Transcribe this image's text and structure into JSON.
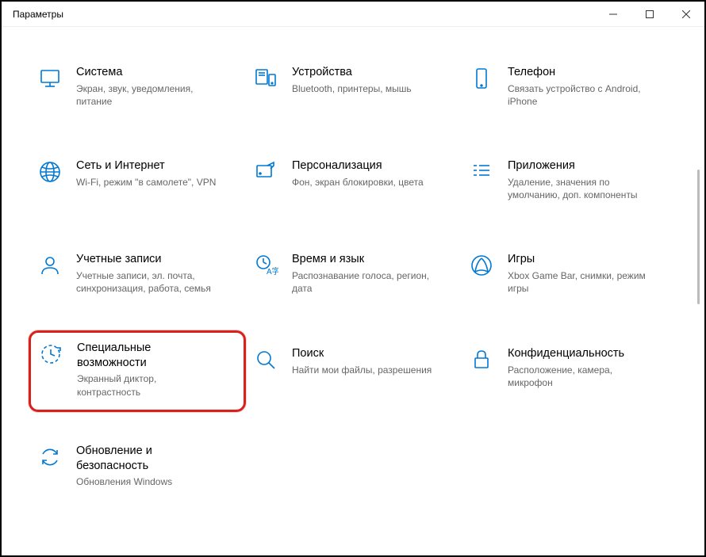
{
  "window": {
    "title": "Параметры"
  },
  "tiles": [
    {
      "title": "Система",
      "desc": "Экран, звук, уведомления, питание"
    },
    {
      "title": "Устройства",
      "desc": "Bluetooth, принтеры, мышь"
    },
    {
      "title": "Телефон",
      "desc": "Связать устройство с Android, iPhone"
    },
    {
      "title": "Сеть и Интернет",
      "desc": "Wi-Fi, режим \"в самолете\", VPN"
    },
    {
      "title": "Персонализация",
      "desc": "Фон, экран блокировки, цвета"
    },
    {
      "title": "Приложения",
      "desc": "Удаление, значения по умолчанию, доп. компоненты"
    },
    {
      "title": "Учетные записи",
      "desc": "Учетные записи, эл. почта, синхронизация, работа, семья"
    },
    {
      "title": "Время и язык",
      "desc": "Распознавание голоса, регион, дата"
    },
    {
      "title": "Игры",
      "desc": "Xbox Game Bar, снимки, режим игры"
    },
    {
      "title": "Специальные возможности",
      "desc": "Экранный диктор, контрастность"
    },
    {
      "title": "Поиск",
      "desc": "Найти мои файлы, разрешения"
    },
    {
      "title": "Конфиденциальность",
      "desc": "Расположение, камера, микрофон"
    },
    {
      "title": "Обновление и безопасность",
      "desc": "Обновления Windows"
    }
  ]
}
